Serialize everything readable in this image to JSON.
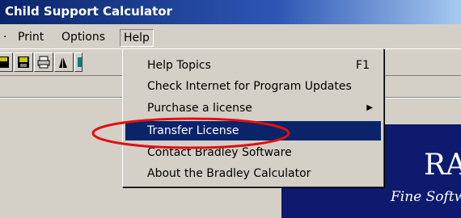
{
  "window": {
    "title": "Child Support Calculator"
  },
  "menubar": {
    "items": [
      {
        "label": "Print"
      },
      {
        "label": "Options"
      },
      {
        "label": "Help"
      }
    ]
  },
  "help_menu": {
    "items": [
      {
        "label": "Help Topics",
        "shortcut": "F1"
      },
      {
        "label": "Check Internet for Program Updates"
      },
      {
        "label": "Purchase a license",
        "submenu": true
      },
      {
        "label": "Transfer License",
        "selected": true
      },
      {
        "label": "Contact Bradley Software"
      },
      {
        "label": "About the Bradley Calculator"
      }
    ]
  },
  "banner": {
    "big_text": "RA",
    "tagline": "Fine Softw"
  },
  "annotation": {
    "color": "#e01010"
  },
  "colors": {
    "title_bar": "#0a246a",
    "selection": "#0a246a",
    "banner": "#0d1a6e"
  }
}
